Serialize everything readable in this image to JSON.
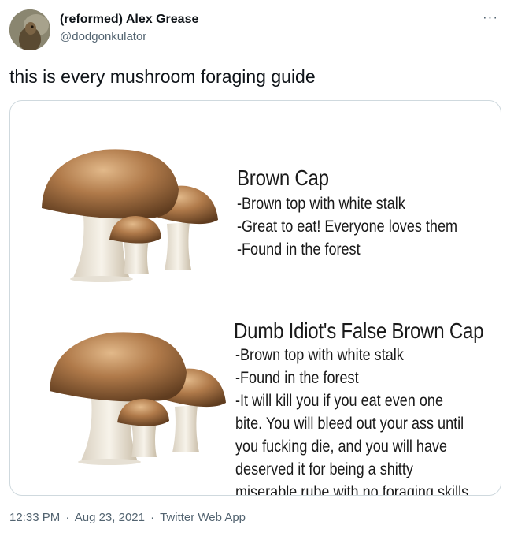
{
  "author": {
    "display_name": "(reformed) Alex Grease",
    "handle": "@dodgonkulator"
  },
  "tweet": {
    "text": "this is every mushroom foraging guide"
  },
  "image": {
    "panel1": {
      "title": "Brown Cap",
      "lines": [
        "-Brown top with white stalk",
        "-Great to eat! Everyone loves them",
        "-Found in the forest"
      ]
    },
    "panel2": {
      "title": "Dumb Idiot's False Brown Cap",
      "lines": [
        "-Brown top with white stalk",
        "-Found in the forest",
        "-It will kill you if you eat even one",
        "bite. You will bleed out your ass until",
        "you fucking die, and you will have",
        "deserved it for being a shitty",
        "miserable rube with no foraging skills"
      ]
    }
  },
  "footer": {
    "time": "12:33 PM",
    "separator": "·",
    "date": "Aug 23, 2021",
    "source": "Twitter Web App"
  },
  "icons": {
    "more": "more-options-icon"
  }
}
